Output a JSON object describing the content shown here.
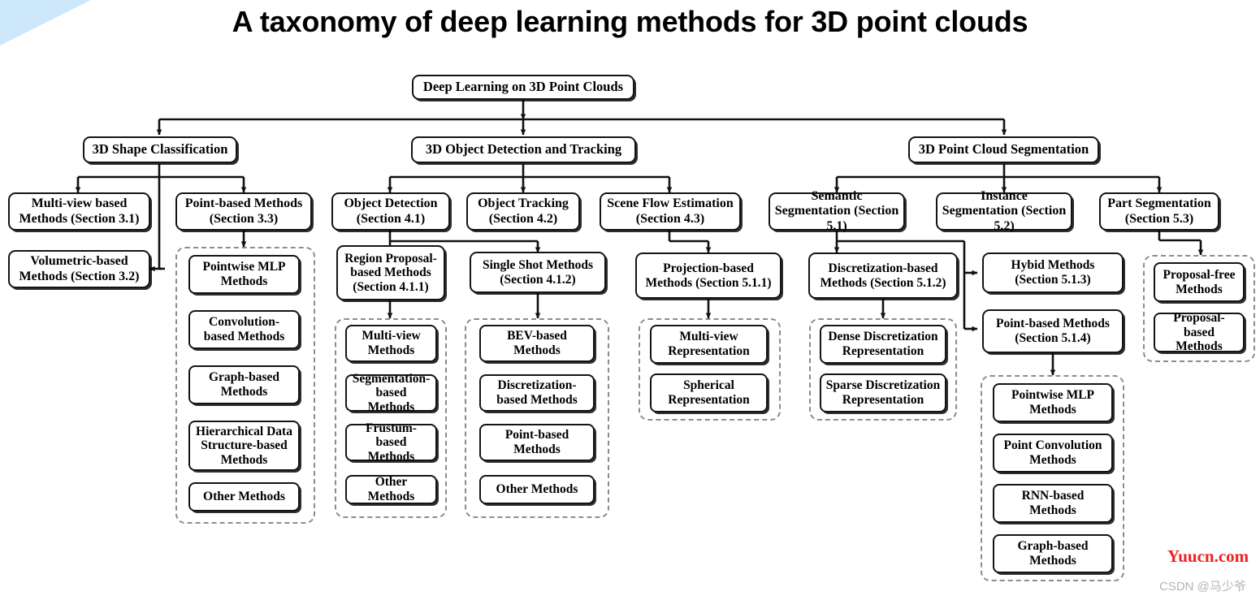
{
  "title": "A taxonomy of deep learning methods for 3D point clouds",
  "root": {
    "label": "Deep Learning on 3D Point Clouds"
  },
  "branches": [
    {
      "label": "3D Shape Classification"
    },
    {
      "label": "3D Object Detection and Tracking"
    },
    {
      "label": "3D Point Cloud Segmentation"
    }
  ],
  "classification": {
    "multiview": "Multi-view based Methods (Section 3.1)",
    "volumetric": "Volumetric-based Methods (Section 3.2)",
    "pointbased": "Point-based Methods (Section 3.3)",
    "pointbased_children": [
      "Pointwise MLP Methods",
      "Convolution-based Methods",
      "Graph-based Methods",
      "Hierarchical Data Structure-based Methods",
      "Other Methods"
    ]
  },
  "detection": {
    "object_detection": "Object Detection (Section 4.1)",
    "object_tracking": "Object Tracking (Section 4.2)",
    "scene_flow": "Scene Flow Estimation (Section 4.3)",
    "region_proposal": "Region Proposal-based Methods (Section 4.1.1)",
    "single_shot": "Single Shot Methods (Section 4.1.2)",
    "region_proposal_children": [
      "Multi-view Methods",
      "Segmentation-based Methods",
      "Frustum-based Methods",
      "Other Methods"
    ],
    "single_shot_children": [
      "BEV-based Methods",
      "Discretization-based Methods",
      "Point-based Methods",
      "Other Methods"
    ]
  },
  "segmentation": {
    "semantic": "Semantic Segmentation (Section 5.1)",
    "instance": "Instance Segmentation (Section 5.2)",
    "part": "Part Segmentation (Section 5.3)",
    "projection": "Projection-based Methods (Section 5.1.1)",
    "discretization": "Discretization-based Methods (Section 5.1.2)",
    "hybrid": "Hybid Methods (Section 5.1.3)",
    "point_based": "Point-based Methods (Section 5.1.4)",
    "projection_children": [
      "Multi-view Representation",
      "Spherical Representation"
    ],
    "discretization_children": [
      "Dense Discretization Representation",
      "Sparse Discretization Representation"
    ],
    "point_based_children": [
      "Pointwise MLP Methods",
      "Point Convolution Methods",
      "RNN-based Methods",
      "Graph-based Methods"
    ],
    "instance_children": [
      "Proposal-free Methods",
      "Proposal-based Methods"
    ]
  },
  "watermarks": {
    "site": "Yuucn.com",
    "author": "CSDN @马少爷"
  },
  "colors": {
    "accent_corner": "#cce8fa",
    "node_border": "#141414",
    "dashed_border": "#8c8c8c",
    "watermark_red": "#ee2222",
    "watermark_gray": "#b4b4b4"
  }
}
